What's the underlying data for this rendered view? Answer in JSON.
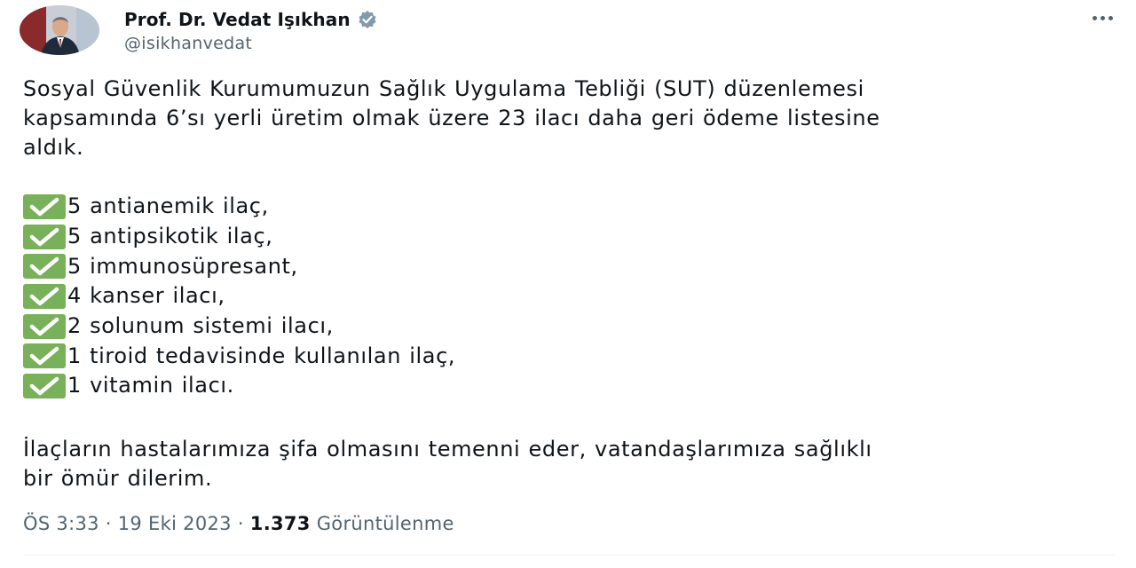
{
  "author": {
    "display_name": "Prof. Dr. Vedat Işıkhan",
    "handle": "@isikhanvedat",
    "verified_icon": "verified-badge-icon",
    "avatar_icon": "avatar-photo"
  },
  "more_icon": "more-options-icon",
  "tweet": {
    "intro": "Sosyal Güvenlik Kurumumuzun Sağlık Uygulama Tebliği (SUT) düzenlemesi\nkapsamında 6’sı yerli üretim olmak üzere 23 ilacı daha geri ödeme listesine\naldık.",
    "list": [
      "5 antianemik ilaç,",
      "5 antipsikotik ilaç,",
      "5 immunosüpresant,",
      "4 kanser ilacı,",
      "2 solunum sistemi ilacı,",
      "1 tiroid tedavisinde kullanılan ilaç,",
      "1 vitamin ilacı."
    ],
    "list_icon": "check-mark-button-icon",
    "check_color": "#78b159",
    "closing": "İlaçların hastalarımıza şifa olmasını temenni eder, vatandaşlarımıza sağlıklı\nbir ömür dilerim."
  },
  "meta": {
    "time": "ÖS 3:33",
    "separator": "·",
    "date": "19 Eki 2023",
    "views_count": "1.373",
    "views_label": "Görüntülenme"
  },
  "colors": {
    "text": "#0f1419",
    "secondary": "#536471",
    "verified": "#829aab"
  }
}
